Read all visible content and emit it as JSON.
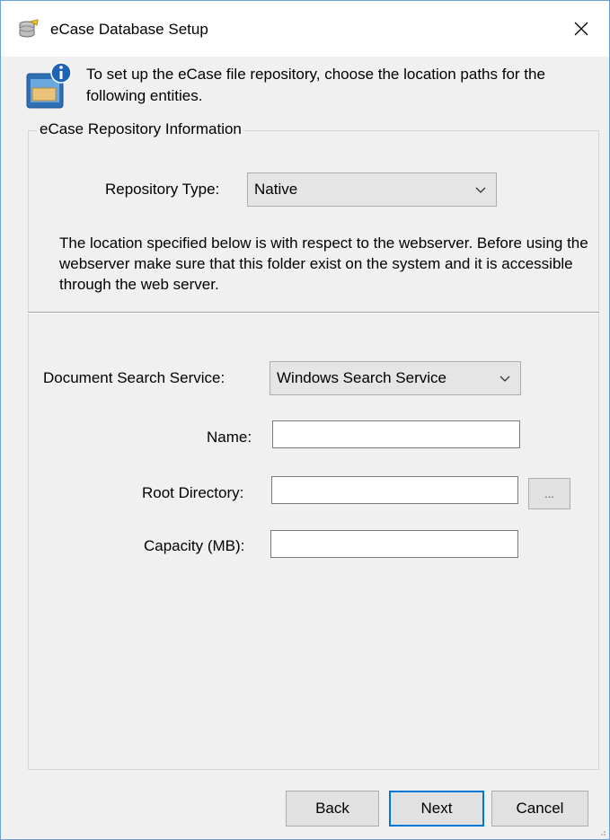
{
  "window": {
    "title": "eCase Database Setup",
    "app_icon": "database-icon",
    "close_icon": "close-icon"
  },
  "intro": {
    "icon": "info-folder-icon",
    "text": "To set up the eCase file repository, choose the location paths for the following entities."
  },
  "repository_group": {
    "legend": "eCase Repository Information",
    "repository_type_label": "Repository Type:",
    "repository_type_value": "Native",
    "note": "The location specified below is with respect to the webserver. Before using the webserver make sure that this folder exist on the system and it is accessible through the web server."
  },
  "form": {
    "search_service_label": "Document Search Service:",
    "search_service_value": "Windows Search Service",
    "name_label": "Name:",
    "name_value": "",
    "root_dir_label": "Root Directory:",
    "root_dir_value": "",
    "browse_label": "...",
    "capacity_label": "Capacity (MB):",
    "capacity_value": ""
  },
  "buttons": {
    "back": "Back",
    "next": "Next",
    "cancel": "Cancel"
  },
  "colors": {
    "window_border": "#6f9fd8",
    "default_button_border": "#0078d7",
    "dialog_bg": "#f0f0f0"
  }
}
